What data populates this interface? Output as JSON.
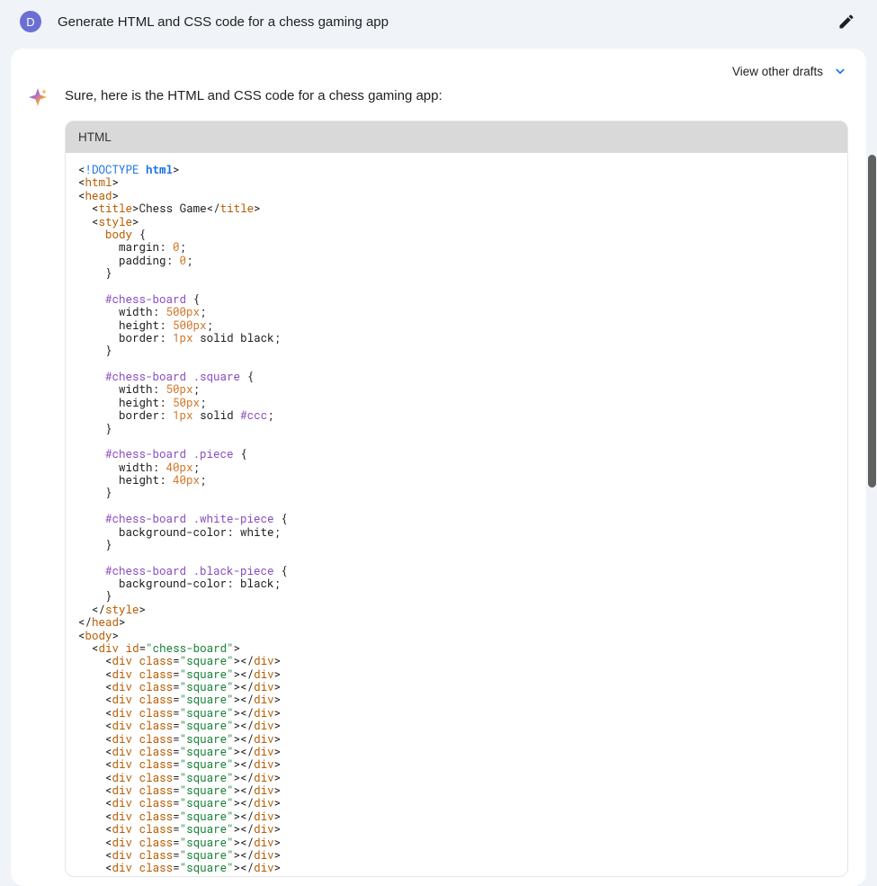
{
  "user": {
    "avatar_letter": "D",
    "prompt": "Generate HTML and CSS code for a chess gaming app"
  },
  "header": {
    "drafts_label": "View other drafts"
  },
  "response": {
    "intro": "Sure, here is the HTML and CSS code for a chess gaming app:",
    "code_lang": "HTML"
  },
  "code": {
    "doctype": "<!DOCTYPE ",
    "html_kw": "html",
    "doctype_close": ">",
    "tags": {
      "html": "html",
      "head": "head",
      "title": "title",
      "style": "style",
      "body": "body",
      "div": "div"
    },
    "title_text": "Chess Game",
    "css": {
      "sel_body": "body",
      "rule_margin": "margin",
      "val_0": "0",
      "rule_padding": "padding",
      "sel_board": "#chess-board",
      "rule_width": "width",
      "val_500px": "500px",
      "rule_height": "height",
      "rule_border": "border",
      "val_1px": "1px",
      "kw_solid": "solid",
      "kw_black": "black",
      "sel_square": "#chess-board .square",
      "val_50px": "50px",
      "val_ccc": "#ccc",
      "sel_piece": "#chess-board .piece",
      "val_40px": "40px",
      "sel_white_piece": "#chess-board .white-piece",
      "rule_bg": "background-color",
      "kw_white": "white",
      "sel_black_piece": "#chess-board .black-piece"
    },
    "attr": {
      "id": "id",
      "class": "class",
      "val_chess_board": "\"chess-board\"",
      "val_square": "\"square\""
    },
    "square_div_count": 17
  }
}
